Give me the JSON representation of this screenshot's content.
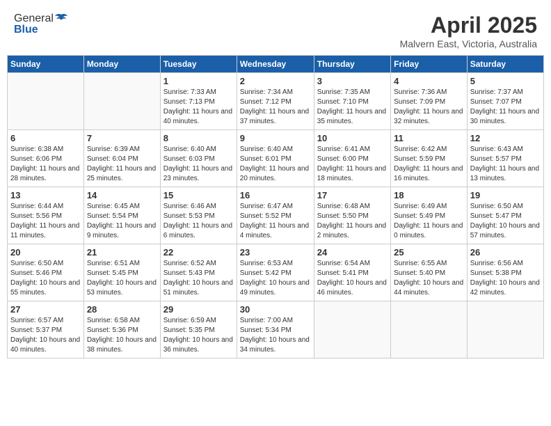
{
  "header": {
    "logo_general": "General",
    "logo_blue": "Blue",
    "month_title": "April 2025",
    "subtitle": "Malvern East, Victoria, Australia"
  },
  "calendar": {
    "days_of_week": [
      "Sunday",
      "Monday",
      "Tuesday",
      "Wednesday",
      "Thursday",
      "Friday",
      "Saturday"
    ],
    "weeks": [
      [
        {
          "day": "",
          "detail": ""
        },
        {
          "day": "",
          "detail": ""
        },
        {
          "day": "1",
          "detail": "Sunrise: 7:33 AM\nSunset: 7:13 PM\nDaylight: 11 hours and 40 minutes."
        },
        {
          "day": "2",
          "detail": "Sunrise: 7:34 AM\nSunset: 7:12 PM\nDaylight: 11 hours and 37 minutes."
        },
        {
          "day": "3",
          "detail": "Sunrise: 7:35 AM\nSunset: 7:10 PM\nDaylight: 11 hours and 35 minutes."
        },
        {
          "day": "4",
          "detail": "Sunrise: 7:36 AM\nSunset: 7:09 PM\nDaylight: 11 hours and 32 minutes."
        },
        {
          "day": "5",
          "detail": "Sunrise: 7:37 AM\nSunset: 7:07 PM\nDaylight: 11 hours and 30 minutes."
        }
      ],
      [
        {
          "day": "6",
          "detail": "Sunrise: 6:38 AM\nSunset: 6:06 PM\nDaylight: 11 hours and 28 minutes."
        },
        {
          "day": "7",
          "detail": "Sunrise: 6:39 AM\nSunset: 6:04 PM\nDaylight: 11 hours and 25 minutes."
        },
        {
          "day": "8",
          "detail": "Sunrise: 6:40 AM\nSunset: 6:03 PM\nDaylight: 11 hours and 23 minutes."
        },
        {
          "day": "9",
          "detail": "Sunrise: 6:40 AM\nSunset: 6:01 PM\nDaylight: 11 hours and 20 minutes."
        },
        {
          "day": "10",
          "detail": "Sunrise: 6:41 AM\nSunset: 6:00 PM\nDaylight: 11 hours and 18 minutes."
        },
        {
          "day": "11",
          "detail": "Sunrise: 6:42 AM\nSunset: 5:59 PM\nDaylight: 11 hours and 16 minutes."
        },
        {
          "day": "12",
          "detail": "Sunrise: 6:43 AM\nSunset: 5:57 PM\nDaylight: 11 hours and 13 minutes."
        }
      ],
      [
        {
          "day": "13",
          "detail": "Sunrise: 6:44 AM\nSunset: 5:56 PM\nDaylight: 11 hours and 11 minutes."
        },
        {
          "day": "14",
          "detail": "Sunrise: 6:45 AM\nSunset: 5:54 PM\nDaylight: 11 hours and 9 minutes."
        },
        {
          "day": "15",
          "detail": "Sunrise: 6:46 AM\nSunset: 5:53 PM\nDaylight: 11 hours and 6 minutes."
        },
        {
          "day": "16",
          "detail": "Sunrise: 6:47 AM\nSunset: 5:52 PM\nDaylight: 11 hours and 4 minutes."
        },
        {
          "day": "17",
          "detail": "Sunrise: 6:48 AM\nSunset: 5:50 PM\nDaylight: 11 hours and 2 minutes."
        },
        {
          "day": "18",
          "detail": "Sunrise: 6:49 AM\nSunset: 5:49 PM\nDaylight: 11 hours and 0 minutes."
        },
        {
          "day": "19",
          "detail": "Sunrise: 6:50 AM\nSunset: 5:47 PM\nDaylight: 10 hours and 57 minutes."
        }
      ],
      [
        {
          "day": "20",
          "detail": "Sunrise: 6:50 AM\nSunset: 5:46 PM\nDaylight: 10 hours and 55 minutes."
        },
        {
          "day": "21",
          "detail": "Sunrise: 6:51 AM\nSunset: 5:45 PM\nDaylight: 10 hours and 53 minutes."
        },
        {
          "day": "22",
          "detail": "Sunrise: 6:52 AM\nSunset: 5:43 PM\nDaylight: 10 hours and 51 minutes."
        },
        {
          "day": "23",
          "detail": "Sunrise: 6:53 AM\nSunset: 5:42 PM\nDaylight: 10 hours and 49 minutes."
        },
        {
          "day": "24",
          "detail": "Sunrise: 6:54 AM\nSunset: 5:41 PM\nDaylight: 10 hours and 46 minutes."
        },
        {
          "day": "25",
          "detail": "Sunrise: 6:55 AM\nSunset: 5:40 PM\nDaylight: 10 hours and 44 minutes."
        },
        {
          "day": "26",
          "detail": "Sunrise: 6:56 AM\nSunset: 5:38 PM\nDaylight: 10 hours and 42 minutes."
        }
      ],
      [
        {
          "day": "27",
          "detail": "Sunrise: 6:57 AM\nSunset: 5:37 PM\nDaylight: 10 hours and 40 minutes."
        },
        {
          "day": "28",
          "detail": "Sunrise: 6:58 AM\nSunset: 5:36 PM\nDaylight: 10 hours and 38 minutes."
        },
        {
          "day": "29",
          "detail": "Sunrise: 6:59 AM\nSunset: 5:35 PM\nDaylight: 10 hours and 36 minutes."
        },
        {
          "day": "30",
          "detail": "Sunrise: 7:00 AM\nSunset: 5:34 PM\nDaylight: 10 hours and 34 minutes."
        },
        {
          "day": "",
          "detail": ""
        },
        {
          "day": "",
          "detail": ""
        },
        {
          "day": "",
          "detail": ""
        }
      ]
    ]
  }
}
